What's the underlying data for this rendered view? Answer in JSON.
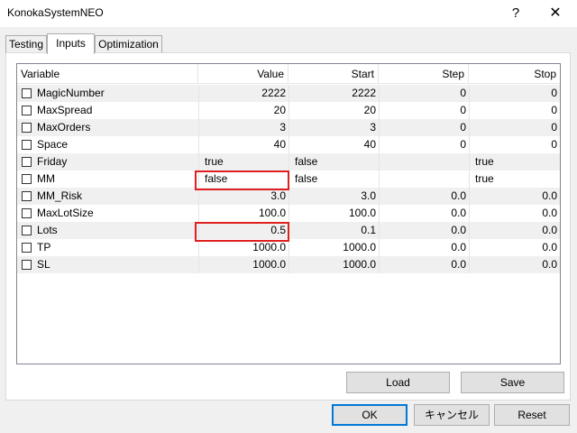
{
  "window": {
    "title": "KonokaSystemNEO",
    "help": "?",
    "close": "✕"
  },
  "tabs": [
    {
      "label": "Testing"
    },
    {
      "label": "Inputs"
    },
    {
      "label": "Optimization"
    }
  ],
  "active_tab": "Inputs",
  "table": {
    "headers": {
      "variable": "Variable",
      "value": "Value",
      "start": "Start",
      "step": "Step",
      "stop": "Stop"
    },
    "rows": [
      {
        "name": "MagicNumber",
        "value": "2222",
        "start": "2222",
        "step": "0",
        "stop": "0",
        "checked": false
      },
      {
        "name": "MaxSpread",
        "value": "20",
        "start": "20",
        "step": "0",
        "stop": "0",
        "checked": false
      },
      {
        "name": "MaxOrders",
        "value": "3",
        "start": "3",
        "step": "0",
        "stop": "0",
        "checked": false
      },
      {
        "name": "Space",
        "value": "40",
        "start": "40",
        "step": "0",
        "stop": "0",
        "checked": false
      },
      {
        "name": "Friday",
        "value": "true",
        "start": "false",
        "step": "",
        "stop": "true",
        "checked": false
      },
      {
        "name": "MM",
        "value": "false",
        "start": "false",
        "step": "",
        "stop": "true",
        "checked": false,
        "highlighted": true
      },
      {
        "name": "MM_Risk",
        "value": "3.0",
        "start": "3.0",
        "step": "0.0",
        "stop": "0.0",
        "checked": false
      },
      {
        "name": "MaxLotSize",
        "value": "100.0",
        "start": "100.0",
        "step": "0.0",
        "stop": "0.0",
        "checked": false
      },
      {
        "name": "Lots",
        "value": "0.5",
        "start": "0.1",
        "step": "0.0",
        "stop": "0.0",
        "checked": false,
        "highlighted": true
      },
      {
        "name": "TP",
        "value": "1000.0",
        "start": "1000.0",
        "step": "0.0",
        "stop": "0.0",
        "checked": false
      },
      {
        "name": "SL",
        "value": "1000.0",
        "start": "1000.0",
        "step": "0.0",
        "stop": "0.0",
        "checked": false
      }
    ]
  },
  "panel_buttons": {
    "load": "Load",
    "save": "Save"
  },
  "dialog_buttons": {
    "ok": "OK",
    "cancel": "キャンセル",
    "reset": "Reset"
  },
  "colors": {
    "highlight": "#e02020",
    "alt_row": "#f0f0f0",
    "default_button_border": "#0078d7"
  }
}
